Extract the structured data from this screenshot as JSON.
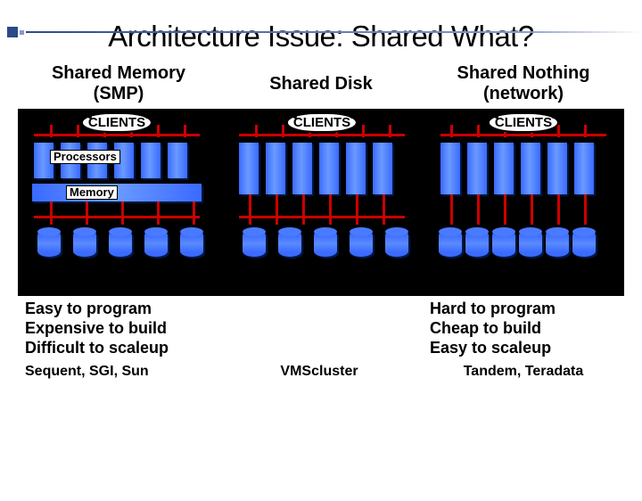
{
  "title": "Architecture Issue: Shared What?",
  "columns": [
    {
      "heading": "Shared Memory\n(SMP)",
      "clients": "CLIENTS"
    },
    {
      "heading": "Shared Disk",
      "clients": "CLIENTS"
    },
    {
      "heading": "Shared Nothing\n(network)",
      "clients": "CLIENTS"
    }
  ],
  "labels": {
    "processors": "Processors",
    "memory": "Memory"
  },
  "bottom": {
    "left_bullets": [
      "Easy to program",
      "Expensive to build",
      "Difficult to scaleup"
    ],
    "left_vendor": "Sequent, SGI, Sun",
    "center_vendor": "VMScluster",
    "right_bullets": [
      "Hard to program",
      "Cheap to build",
      "Easy to scaleup"
    ],
    "right_vendor": "Tandem, Teradata"
  }
}
